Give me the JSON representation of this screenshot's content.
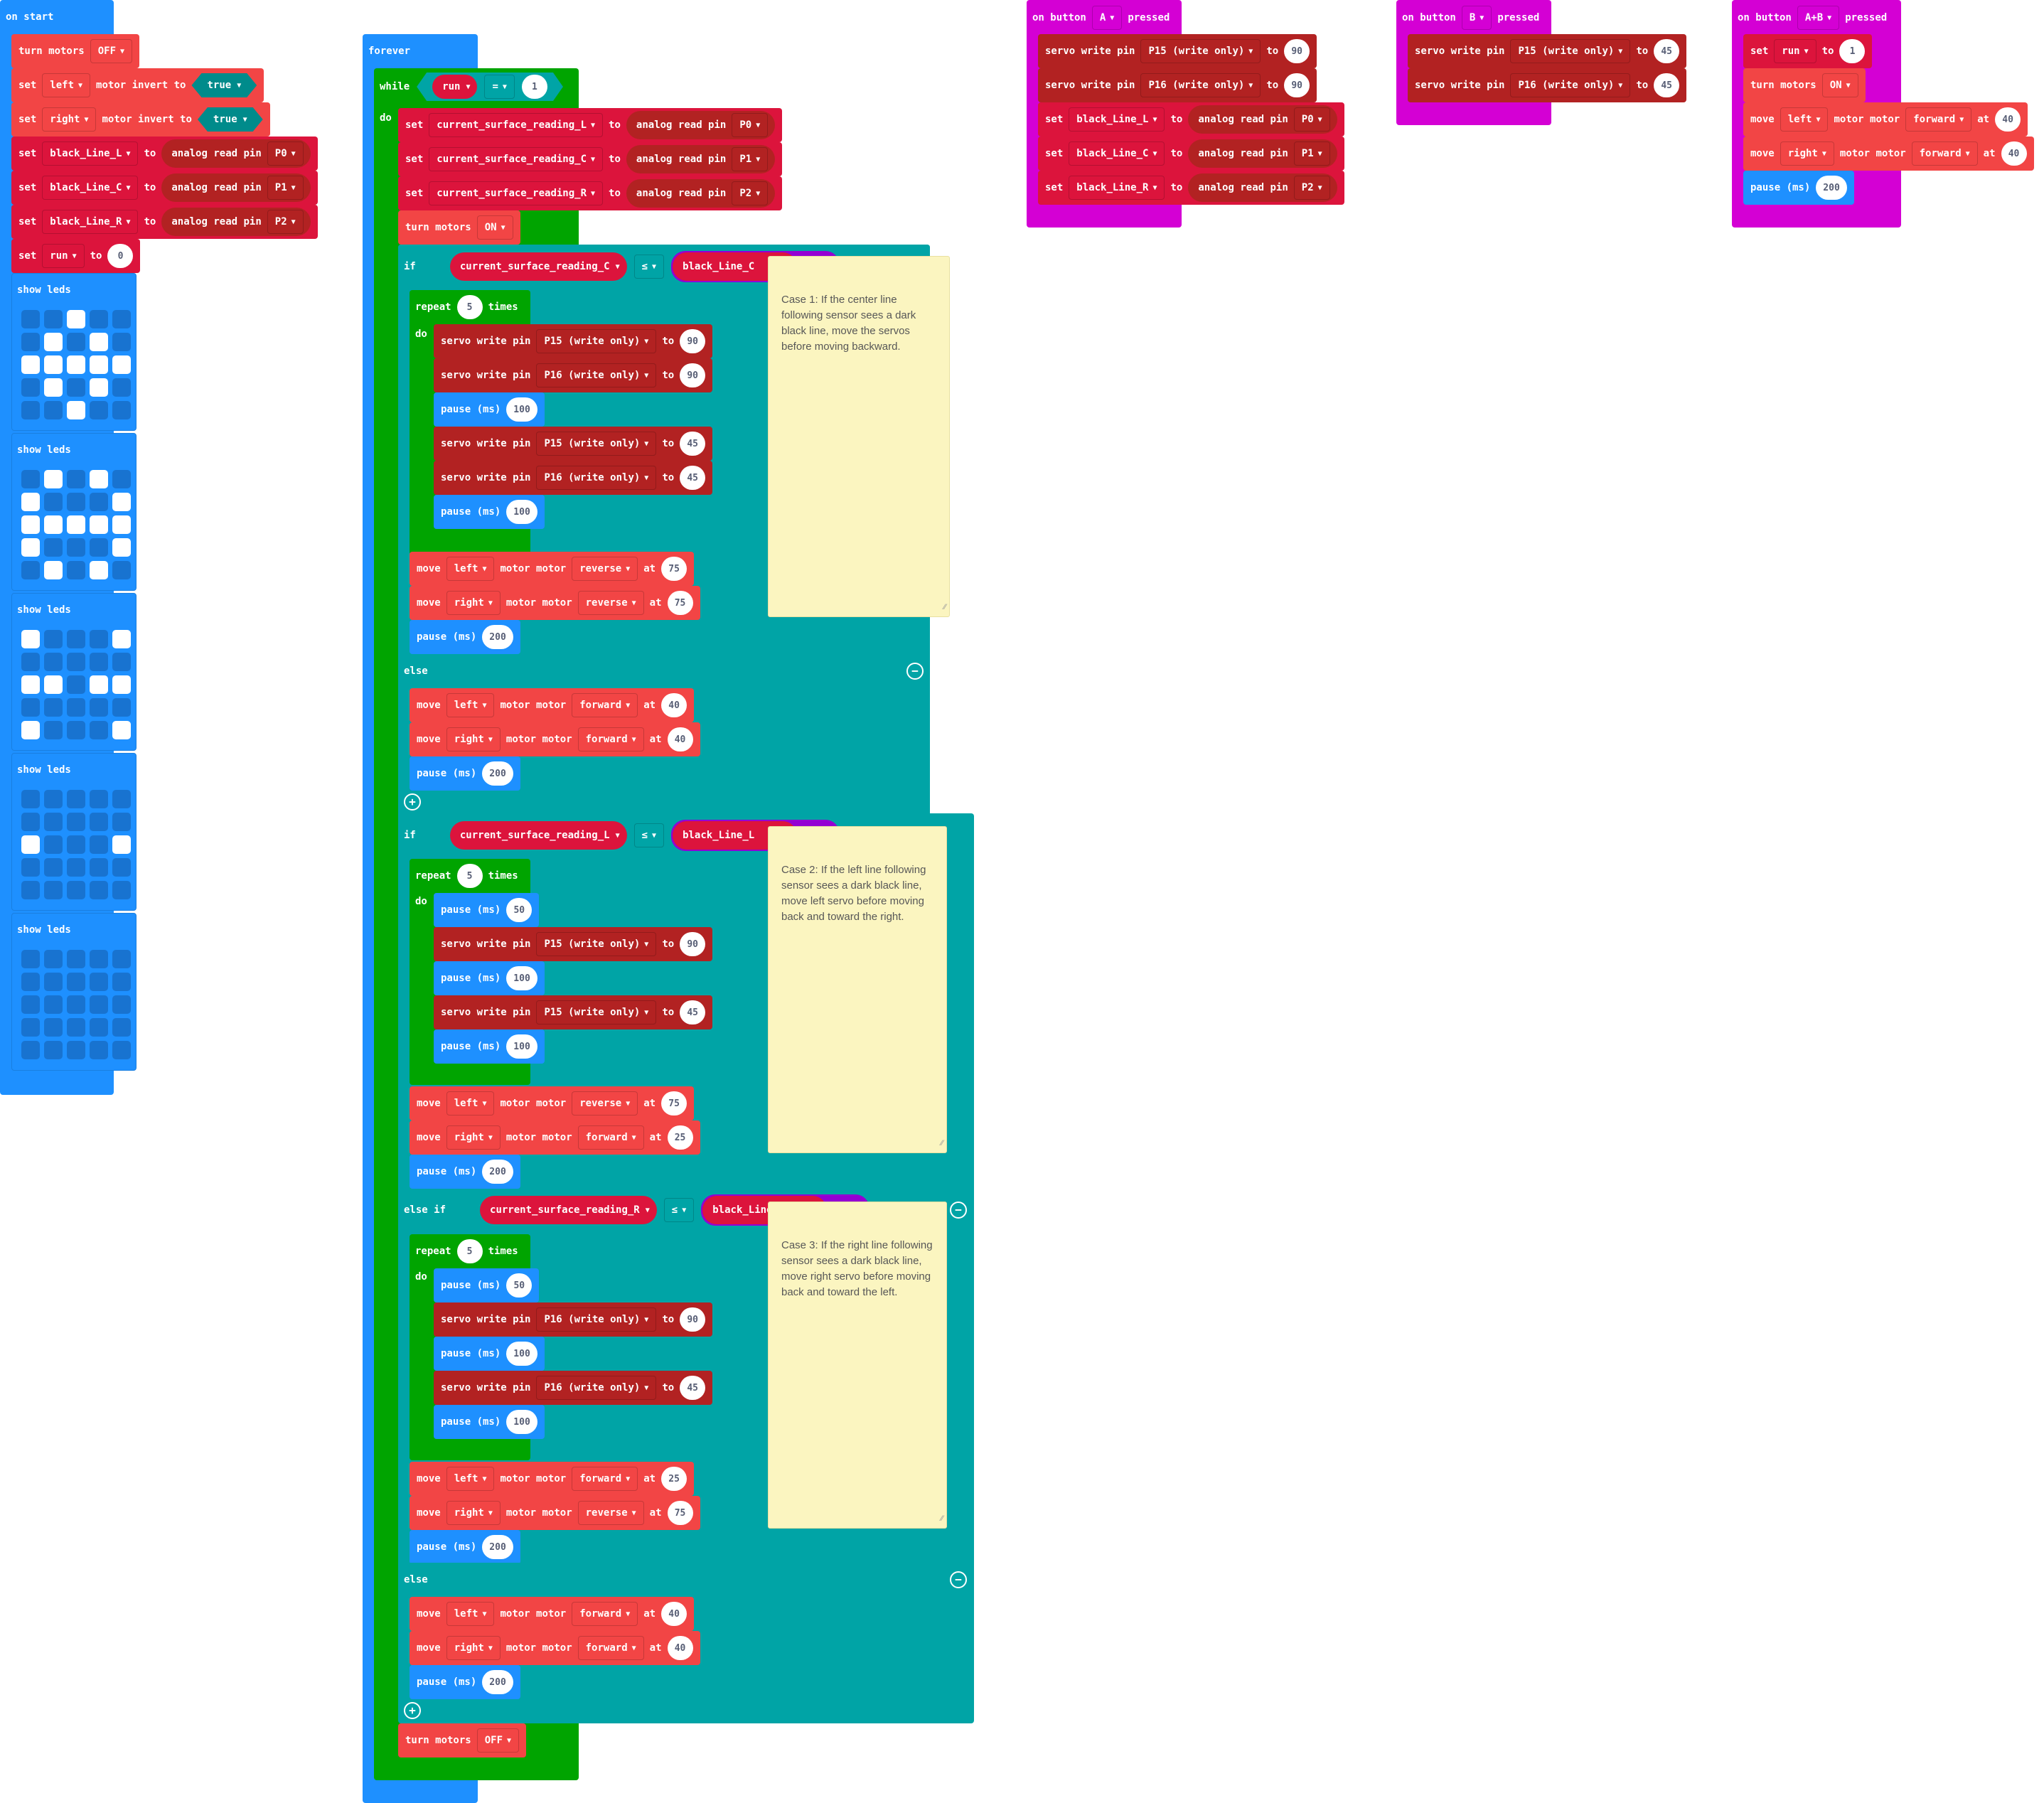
{
  "on_start": {
    "header": "on start",
    "turn_motors": {
      "label": "turn motors",
      "value": "OFF"
    },
    "invert_left": {
      "set": "set",
      "motor": "left",
      "label": "motor invert to",
      "value": "true"
    },
    "invert_right": {
      "set": "set",
      "motor": "right",
      "label": "motor invert to",
      "value": "true"
    },
    "vars": [
      {
        "set": "set",
        "name": "black_Line_L",
        "to": "to",
        "reader": "analog read pin",
        "pin": "P0"
      },
      {
        "set": "set",
        "name": "black_Line_C",
        "to": "to",
        "reader": "analog read pin",
        "pin": "P1"
      },
      {
        "set": "set",
        "name": "black_Line_R",
        "to": "to",
        "reader": "analog read pin",
        "pin": "P2"
      }
    ],
    "set_run": {
      "set": "set",
      "name": "run",
      "to": "to",
      "value": "0"
    },
    "show_leds_label": "show leds",
    "led_patterns": [
      [
        [
          0,
          0,
          1,
          0,
          0
        ],
        [
          0,
          1,
          0,
          1,
          0
        ],
        [
          1,
          1,
          1,
          1,
          1
        ],
        [
          0,
          1,
          0,
          1,
          0
        ],
        [
          0,
          0,
          1,
          0,
          0
        ]
      ],
      [
        [
          0,
          1,
          0,
          1,
          0
        ],
        [
          1,
          0,
          0,
          0,
          1
        ],
        [
          1,
          1,
          1,
          1,
          1
        ],
        [
          1,
          0,
          0,
          0,
          1
        ],
        [
          0,
          1,
          0,
          1,
          0
        ]
      ],
      [
        [
          1,
          0,
          0,
          0,
          1
        ],
        [
          0,
          0,
          0,
          0,
          0
        ],
        [
          1,
          1,
          0,
          1,
          1
        ],
        [
          0,
          0,
          0,
          0,
          0
        ],
        [
          1,
          0,
          0,
          0,
          1
        ]
      ],
      [
        [
          0,
          0,
          0,
          0,
          0
        ],
        [
          0,
          0,
          0,
          0,
          0
        ],
        [
          1,
          0,
          0,
          0,
          1
        ],
        [
          0,
          0,
          0,
          0,
          0
        ],
        [
          0,
          0,
          0,
          0,
          0
        ]
      ],
      [
        [
          0,
          0,
          0,
          0,
          0
        ],
        [
          0,
          0,
          0,
          0,
          0
        ],
        [
          0,
          0,
          0,
          0,
          0
        ],
        [
          0,
          0,
          0,
          0,
          0
        ],
        [
          0,
          0,
          0,
          0,
          0
        ]
      ]
    ]
  },
  "forever": {
    "header": "forever",
    "while": {
      "label": "while",
      "var": "run",
      "op": "=",
      "value": "1",
      "do": "do"
    },
    "reads": [
      {
        "set": "set",
        "name": "current_surface_reading_L",
        "to": "to",
        "reader": "analog read pin",
        "pin": "P0"
      },
      {
        "set": "set",
        "name": "current_surface_reading_C",
        "to": "to",
        "reader": "analog read pin",
        "pin": "P1"
      },
      {
        "set": "set",
        "name": "current_surface_reading_R",
        "to": "to",
        "reader": "analog read pin",
        "pin": "P2"
      }
    ],
    "turn_on": {
      "label": "turn motors",
      "value": "ON"
    },
    "if1": {
      "label": "if",
      "left": "current_surface_reading_C",
      "op": "≤",
      "right": "black_Line_C",
      "repeat": {
        "label": "repeat",
        "count": "5",
        "times": "times",
        "do": "do"
      },
      "else": "else"
    },
    "if2": {
      "label": "if",
      "left": "current_surface_reading_L",
      "op": "≤",
      "right": "black_Line_L",
      "elseif_label": "else if",
      "elseif_left": "current_surface_reading_R",
      "elseif_op": "≤",
      "elseif_right": "black_Line_R",
      "repeat": {
        "label": "repeat",
        "count": "5",
        "times": "times",
        "do": "do"
      },
      "else": "else"
    },
    "turn_off": {
      "label": "turn motors",
      "value": "OFF"
    }
  },
  "labels": {
    "servo": "servo write pin",
    "to": "to",
    "pause": "pause (ms)",
    "move": "move",
    "motor_motor": "motor motor",
    "at": "at",
    "p15": "P15 (write only)",
    "p16": "P16 (write only)"
  },
  "comments": {
    "case1": "Case 1: If the center line following sensor sees a dark black line, move the servos before moving backward.",
    "case2": "Case 2: If the left line following sensor sees a dark black line, move left servo before moving back and toward the right.",
    "case3": "Case 3: If the right line following sensor sees a dark black line, move right servo before moving back and toward the left."
  },
  "button_a": {
    "on": "on button",
    "button": "A",
    "pressed": "pressed",
    "servo1": {
      "pin": "P15 (write only)",
      "value": "90"
    },
    "servo2": {
      "pin": "P16 (write only)",
      "value": "90"
    },
    "vars": [
      {
        "name": "black_Line_L",
        "pin": "P0"
      },
      {
        "name": "black_Line_C",
        "pin": "P1"
      },
      {
        "name": "black_Line_R",
        "pin": "P2"
      }
    ]
  },
  "button_b": {
    "on": "on button",
    "button": "B",
    "pressed": "pressed",
    "servo1": {
      "pin": "P15 (write only)",
      "value": "45"
    },
    "servo2": {
      "pin": "P16 (write only)",
      "value": "45"
    }
  },
  "button_ab": {
    "on": "on button",
    "button": "A+B",
    "pressed": "pressed",
    "set_run": {
      "name": "run",
      "value": "1"
    },
    "turn_on": "ON",
    "move_left": {
      "motor": "left",
      "dir": "forward",
      "speed": "40"
    },
    "move_right": {
      "motor": "right",
      "dir": "forward",
      "speed": "40"
    },
    "pause": "200"
  },
  "values": {
    "c1_s1": "90",
    "c1_s2": "90",
    "c1_p1": "100",
    "c1_s3": "45",
    "c1_s4": "45",
    "c1_p2": "100",
    "c1_ml": {
      "motor": "left",
      "dir": "reverse",
      "speed": "75"
    },
    "c1_mr": {
      "motor": "right",
      "dir": "reverse",
      "speed": "75"
    },
    "c1_pause": "200",
    "e1_ml": {
      "motor": "left",
      "dir": "forward",
      "speed": "40"
    },
    "e1_mr": {
      "motor": "right",
      "dir": "forward",
      "speed": "40"
    },
    "e1_pause": "200",
    "c2_p0": "50",
    "c2_s1": "90",
    "c2_p1": "100",
    "c2_s2": "45",
    "c2_p2": "100",
    "c2_ml": {
      "motor": "left",
      "dir": "reverse",
      "speed": "75"
    },
    "c2_mr": {
      "motor": "right",
      "dir": "forward",
      "speed": "25"
    },
    "c2_pause": "200",
    "c3_p0": "50",
    "c3_s1": "90",
    "c3_p1": "100",
    "c3_s2": "45",
    "c3_p2": "100",
    "c3_ml": {
      "motor": "left",
      "dir": "forward",
      "speed": "25"
    },
    "c3_mr": {
      "motor": "right",
      "dir": "reverse",
      "speed": "75"
    },
    "c3_pause": "200",
    "e2_ml": {
      "motor": "left",
      "dir": "forward",
      "speed": "40"
    },
    "e2_mr": {
      "motor": "right",
      "dir": "forward",
      "speed": "40"
    },
    "e2_pause": "200"
  }
}
